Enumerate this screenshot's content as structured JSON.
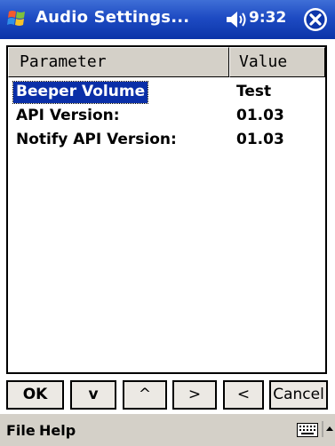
{
  "window": {
    "title": "Audio Settings...",
    "clock": "9:32",
    "icons": {
      "start": "windows-flag-icon",
      "volume": "speaker-icon",
      "close": "close-icon"
    }
  },
  "list": {
    "columns": [
      "Parameter",
      "Value"
    ],
    "rows": [
      {
        "parameter": "Beeper Volume",
        "value": "Test",
        "selected": true
      },
      {
        "parameter": "API Version:",
        "value": "01.03",
        "selected": false
      },
      {
        "parameter": "Notify API Version:",
        "value": "01.03",
        "selected": false
      }
    ]
  },
  "buttons": {
    "ok": "OK",
    "down": "v",
    "up": "^",
    "right": ">",
    "left": "<",
    "cancel": "Cancel"
  },
  "menu": {
    "file": "File",
    "help": "Help",
    "icons": {
      "keyboard": "keyboard-icon",
      "sip": "sip-arrow-icon"
    }
  },
  "colors": {
    "titlebar": "#1e4bc3",
    "selection": "#0a2fa8",
    "menubar": "#d4d0c8"
  }
}
